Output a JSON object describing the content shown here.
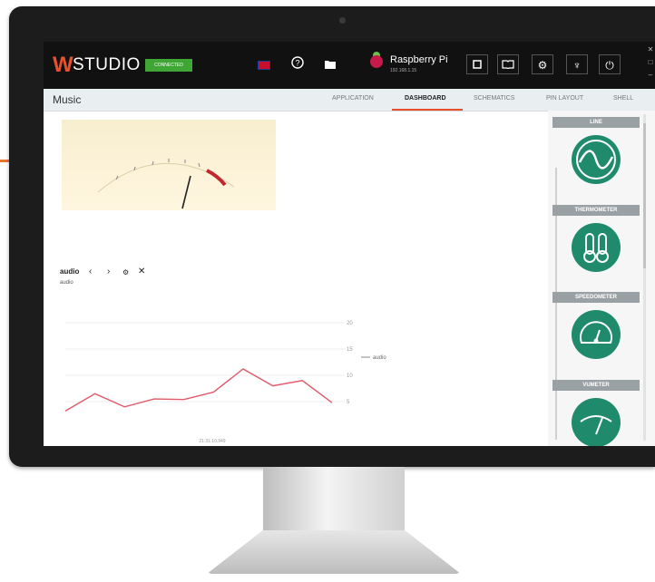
{
  "app": {
    "logo_mark": "W",
    "logo_text": "STUDIO",
    "status_badge": "CONNECTED",
    "device_name": "Raspberry Pi",
    "device_ip": "192.168.1.15"
  },
  "header": {
    "page_title": "Music",
    "tabs": [
      {
        "label": "APPLICATION"
      },
      {
        "label": "DASHBOARD"
      },
      {
        "label": "SCHEMATICS"
      },
      {
        "label": "PIN LAYOUT"
      },
      {
        "label": "SHELL"
      }
    ],
    "active_tab": "DASHBOARD"
  },
  "widget": {
    "title": "audio",
    "subtitle": "audio"
  },
  "chart_data": {
    "type": "line",
    "series": [
      {
        "name": "audio",
        "color": "#e05a6a",
        "values": [
          3.2,
          6.5,
          4.0,
          5.5,
          5.4,
          6.8,
          11.2,
          8.0,
          9.0,
          4.8
        ]
      }
    ],
    "ytick_labels": [
      "20",
      "15",
      "10",
      "5"
    ],
    "xtick_labels": [
      "21:31:10.949"
    ],
    "ylim": [
      0,
      20
    ]
  },
  "sidebar": {
    "widgets": [
      {
        "label": "LINE",
        "icon": "wave-icon"
      },
      {
        "label": "THERMOMETER",
        "icon": "thermometer-icon"
      },
      {
        "label": "SPEEDOMETER",
        "icon": "speedometer-icon"
      },
      {
        "label": "VUMETER",
        "icon": "vumeter-icon"
      }
    ]
  },
  "colors": {
    "accent": "#e8502c",
    "connected": "#3fa535",
    "widget_green": "#1f8a6c",
    "line": "#e05a6a"
  }
}
